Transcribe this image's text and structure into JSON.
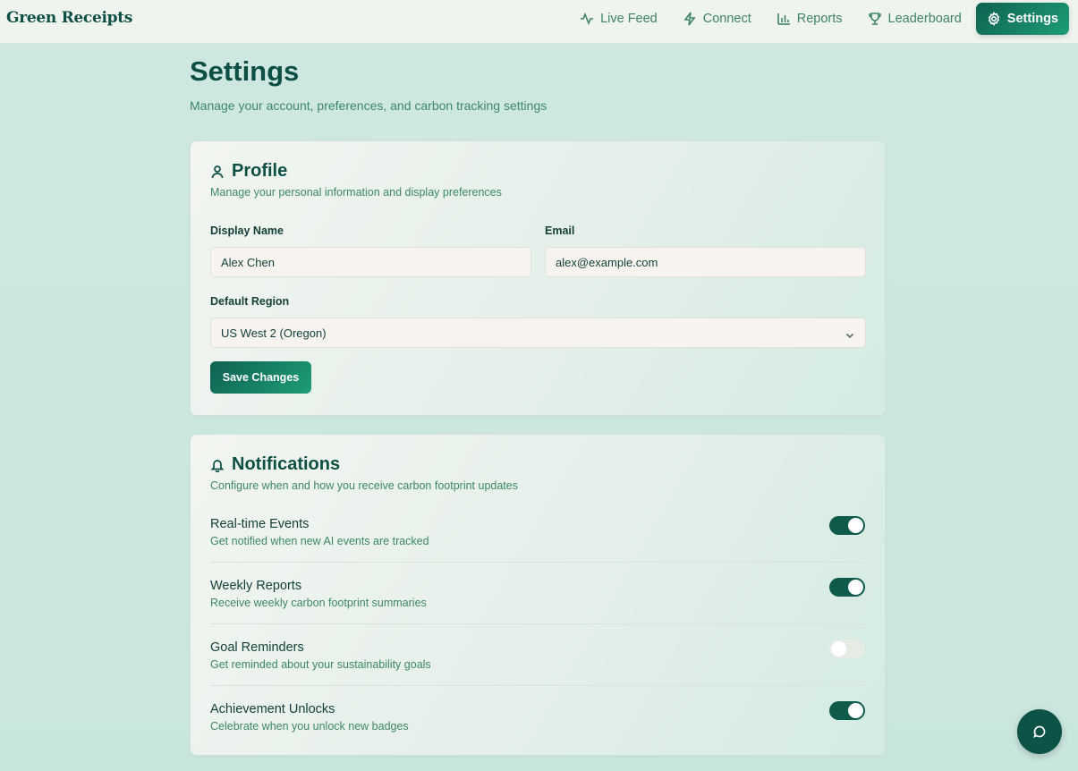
{
  "app": {
    "brand": "Green Receipts"
  },
  "nav": [
    {
      "label": "Live Feed",
      "icon": "activity-icon"
    },
    {
      "label": "Connect",
      "icon": "zap-icon"
    },
    {
      "label": "Reports",
      "icon": "bar-chart-icon"
    },
    {
      "label": "Leaderboard",
      "icon": "trophy-icon"
    },
    {
      "label": "Settings",
      "icon": "gear-icon",
      "active": true
    }
  ],
  "page": {
    "title": "Settings",
    "subtitle": "Manage your account, preferences, and carbon tracking settings"
  },
  "profile": {
    "title": "Profile",
    "description": "Manage your personal information and display preferences",
    "display_name_label": "Display Name",
    "display_name_value": "Alex Chen",
    "email_label": "Email",
    "email_value": "alex@example.com",
    "region_label": "Default Region",
    "region_value": "US West 2 (Oregon)",
    "save_label": "Save Changes"
  },
  "notifications": {
    "title": "Notifications",
    "description": "Configure when and how you receive carbon footprint updates",
    "items": [
      {
        "title": "Real-time Events",
        "description": "Get notified when new AI events are tracked",
        "enabled": true
      },
      {
        "title": "Weekly Reports",
        "description": "Receive weekly carbon footprint summaries",
        "enabled": true
      },
      {
        "title": "Goal Reminders",
        "description": "Get reminded about your sustainability goals",
        "enabled": false
      },
      {
        "title": "Achievement Unlocks",
        "description": "Celebrate when you unlock new badges",
        "enabled": true
      }
    ]
  },
  "colors": {
    "primary": "#0d4f45",
    "accent": "#1d9d76",
    "muted": "#3c8866"
  }
}
